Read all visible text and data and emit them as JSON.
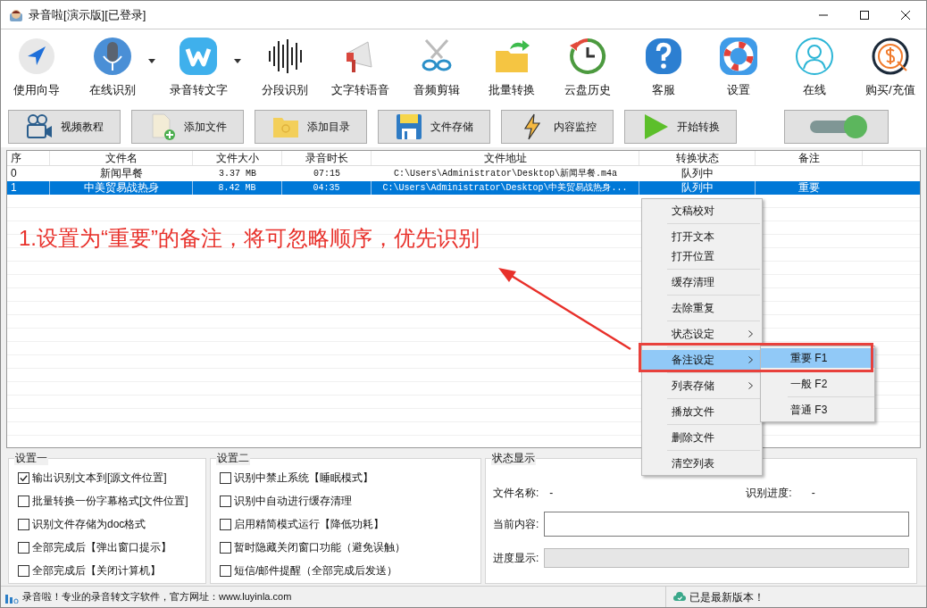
{
  "window": {
    "title": "录音啦[演示版][已登录]"
  },
  "toolbar": [
    {
      "label": "使用向导",
      "dropdown": false
    },
    {
      "label": "在线识别",
      "dropdown": true
    },
    {
      "label": "录音转文字",
      "dropdown": true
    },
    {
      "label": "分段识别",
      "dropdown": false
    },
    {
      "label": "文字转语音",
      "dropdown": false
    },
    {
      "label": "音频剪辑",
      "dropdown": false
    },
    {
      "label": "批量转换",
      "dropdown": false
    },
    {
      "label": "云盘历史",
      "dropdown": false
    },
    {
      "label": "客服",
      "dropdown": false
    },
    {
      "label": "设置",
      "dropdown": false
    },
    {
      "label": "在线",
      "dropdown": false
    },
    {
      "label": "购买/充值",
      "dropdown": false
    }
  ],
  "actions": [
    {
      "label": "视频教程"
    },
    {
      "label": "添加文件"
    },
    {
      "label": "添加目录"
    },
    {
      "label": "文件存储"
    },
    {
      "label": "内容监控"
    },
    {
      "label": "开始转换"
    }
  ],
  "toggle": {
    "on": true
  },
  "table": {
    "columns": [
      {
        "label": "序"
      },
      {
        "label": "文件名"
      },
      {
        "label": "文件大小"
      },
      {
        "label": "录音时长"
      },
      {
        "label": "文件地址"
      },
      {
        "label": "转换状态"
      },
      {
        "label": "备注"
      }
    ],
    "rows": [
      {
        "index": "0",
        "name": "新闻早餐",
        "size": "3.37 MB",
        "duration": "07:15",
        "path": "C:\\Users\\Administrator\\Desktop\\新闻早餐.m4a",
        "status": "队列中",
        "selected": false
      },
      {
        "index": "1",
        "name": "中美贸易战热身",
        "size": "8.42 MB",
        "duration": "04:35",
        "path": "C:\\Users\\Administrator\\Desktop\\中美贸易战热身...",
        "status": "队列中",
        "note": "重要",
        "selected": true
      }
    ]
  },
  "annotation": {
    "text": "1.设置为“重要”的备注，将可忽略顺序，优先识别"
  },
  "context_menu": {
    "items": [
      {
        "kind": "item",
        "label": "文稿校对",
        "submenu": false,
        "selected": false
      },
      {
        "kind": "separator"
      },
      {
        "kind": "item",
        "label": "打开文本",
        "submenu": false,
        "selected": false
      },
      {
        "kind": "item",
        "label": "打开位置",
        "submenu": false,
        "selected": false
      },
      {
        "kind": "separator"
      },
      {
        "kind": "item",
        "label": "缓存清理",
        "submenu": false,
        "selected": false
      },
      {
        "kind": "separator"
      },
      {
        "kind": "item",
        "label": "去除重复",
        "submenu": false,
        "selected": false
      },
      {
        "kind": "separator"
      },
      {
        "kind": "item",
        "label": "状态设定",
        "submenu": true,
        "selected": false
      },
      {
        "kind": "separator"
      },
      {
        "kind": "item",
        "label": "备注设定",
        "submenu": true,
        "selected": true
      },
      {
        "kind": "separator"
      },
      {
        "kind": "item",
        "label": "列表存储",
        "submenu": true,
        "selected": false
      },
      {
        "kind": "separator"
      },
      {
        "kind": "item",
        "label": "播放文件",
        "submenu": false,
        "selected": false
      },
      {
        "kind": "separator"
      },
      {
        "kind": "item",
        "label": "删除文件",
        "submenu": false,
        "selected": false
      },
      {
        "kind": "separator"
      },
      {
        "kind": "item",
        "label": "清空列表",
        "submenu": false,
        "selected": false
      }
    ],
    "submenu": [
      {
        "label": "重要 F1",
        "selected": true
      },
      {
        "label": "一般 F2",
        "selected": false
      },
      {
        "label": "普通 F3",
        "selected": false
      }
    ]
  },
  "settings_one": {
    "title": "设置一",
    "options": [
      {
        "label": "输出识别文本到[源文件位置]",
        "checked": true
      },
      {
        "label": "批量转换一份字幕格式[文件位置]",
        "checked": false
      },
      {
        "label": "识别文件存储为doc格式",
        "checked": false
      },
      {
        "label": "全部完成后【弹出窗口提示】",
        "checked": false
      },
      {
        "label": "全部完成后【关闭计算机】",
        "checked": false
      }
    ]
  },
  "settings_two": {
    "title": "设置二",
    "options": [
      {
        "label": "识别中禁止系统【睡眠模式】",
        "checked": false
      },
      {
        "label": "识别中自动进行缓存清理",
        "checked": false
      },
      {
        "label": "启用精简模式运行【降低功耗】",
        "checked": false
      },
      {
        "label": "暂时隐藏关闭窗口功能（避免误触）",
        "checked": false
      },
      {
        "label": "短信/邮件提醒（全部完成后发送）",
        "checked": false
      }
    ]
  },
  "status_panel": {
    "title": "状态显示",
    "file_name_label": "文件名称:",
    "file_name": "-",
    "progress_label": "识别进度:",
    "progress": "-",
    "content_label": "当前内容:",
    "bar_label": "进度显示:",
    "level": 0
  },
  "status_bar": {
    "left": "录音啦！专业的录音转文字软件，官方网址：www.luyinla.com",
    "right": "已是最新版本！"
  }
}
